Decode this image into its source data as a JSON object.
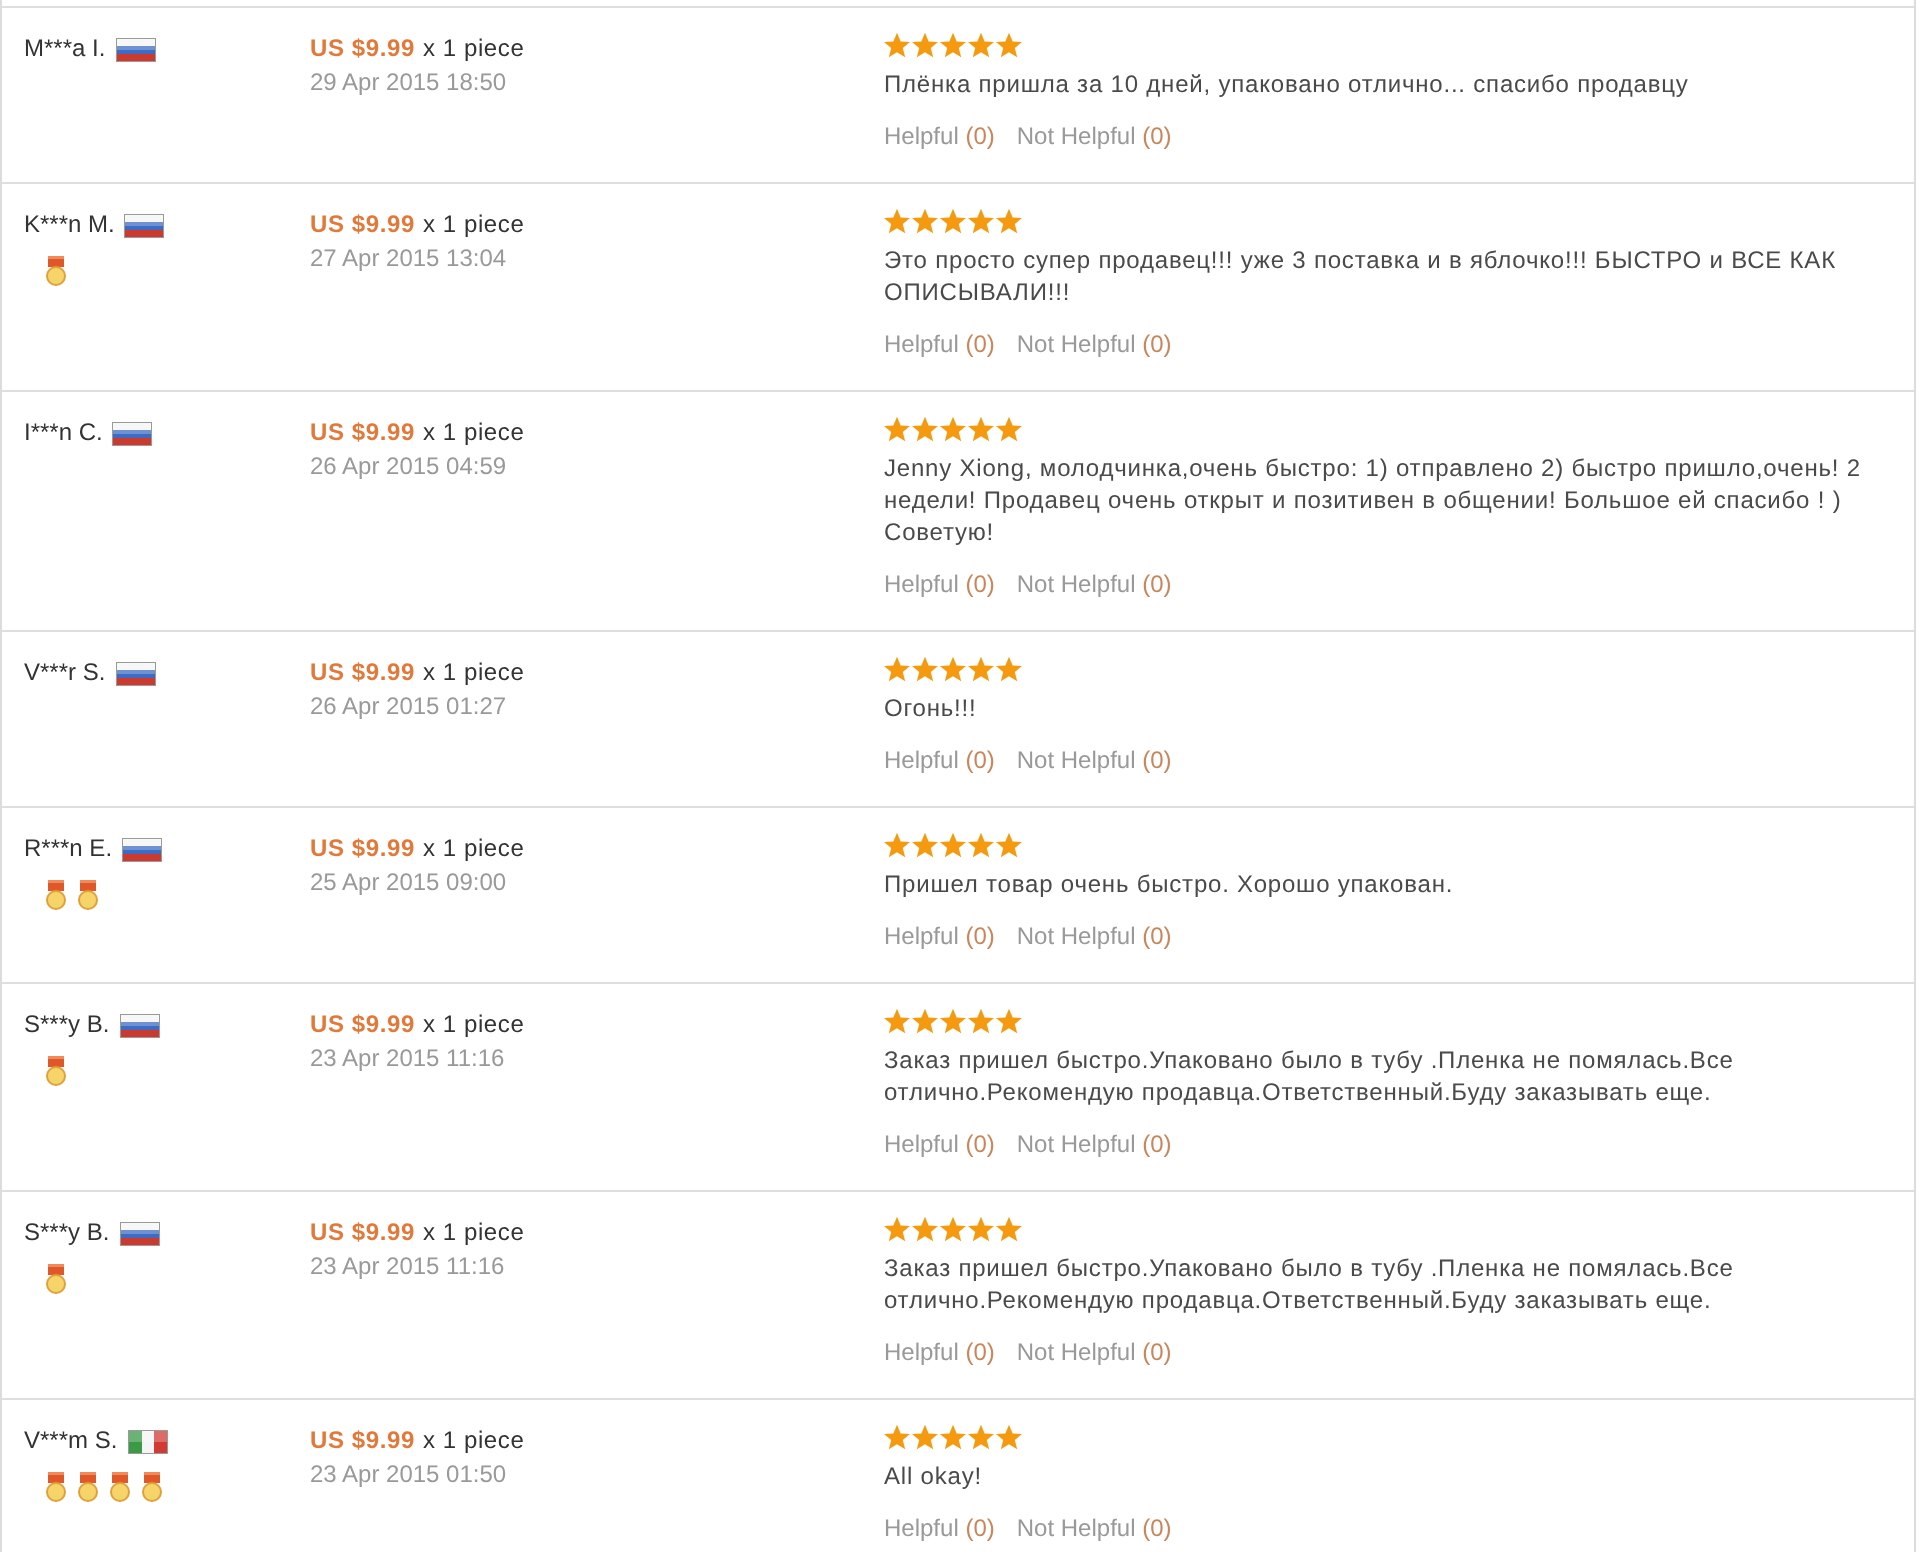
{
  "reviews": [
    {
      "buyer": "M***a I.",
      "flag": {
        "kind": "russia"
      },
      "price": "US $9.99",
      "quantity": "x 1 piece",
      "date": "29 Apr 2015 18:50",
      "stars": 5,
      "text": "Плёнка пришла за 10 дней, упаковано отлично... спасибо продавцу",
      "helpful": {
        "label": "Helpful",
        "count": "(0)"
      },
      "not_helpful": {
        "label": "Not Helpful",
        "count": "(0)"
      }
    },
    {
      "buyer": "K***n M.",
      "flag": {
        "kind": "russia"
      },
      "badges": [
        {
          "kind": "medal"
        }
      ],
      "price": "US $9.99",
      "quantity": "x 1 piece",
      "date": "27 Apr 2015 13:04",
      "stars": 5,
      "text": "Это просто супер продавец!!! уже 3 поставка и в яблочко!!! БЫСТРО и ВСЕ КАК ОПИСЫВАЛИ!!!",
      "helpful": {
        "label": "Helpful",
        "count": "(0)"
      },
      "not_helpful": {
        "label": "Not Helpful",
        "count": "(0)"
      }
    },
    {
      "buyer": "I***n C.",
      "flag": {
        "kind": "russia"
      },
      "price": "US $9.99",
      "quantity": "x 1 piece",
      "date": "26 Apr 2015 04:59",
      "stars": 5,
      "text": "Jenny Xiong, молодчинка,очень быстро: 1) отправлено 2) быстро пришло,очень! 2 недели! Продавец очень открыт и позитивен в общении! Большое ей спасибо ! ) Советую!",
      "helpful": {
        "label": "Helpful",
        "count": "(0)"
      },
      "not_helpful": {
        "label": "Not Helpful",
        "count": "(0)"
      }
    },
    {
      "buyer": "V***r S.",
      "flag": {
        "kind": "russia"
      },
      "price": "US $9.99",
      "quantity": "x 1 piece",
      "date": "26 Apr 2015 01:27",
      "stars": 5,
      "text": "Огонь!!!",
      "helpful": {
        "label": "Helpful",
        "count": "(0)"
      },
      "not_helpful": {
        "label": "Not Helpful",
        "count": "(0)"
      }
    },
    {
      "buyer": "R***n E.",
      "flag": {
        "kind": "russia"
      },
      "badges": [
        {
          "kind": "medal"
        },
        {
          "kind": "medal"
        }
      ],
      "price": "US $9.99",
      "quantity": "x 1 piece",
      "date": "25 Apr 2015 09:00",
      "stars": 5,
      "text": "Пришел товар очень быстро. Хорошо упакован.",
      "helpful": {
        "label": "Helpful",
        "count": "(0)"
      },
      "not_helpful": {
        "label": "Not Helpful",
        "count": "(0)"
      }
    },
    {
      "buyer": "S***y B.",
      "flag": {
        "kind": "russia"
      },
      "badges": [
        {
          "kind": "medal"
        }
      ],
      "price": "US $9.99",
      "quantity": "x 1 piece",
      "date": "23 Apr 2015 11:16",
      "stars": 5,
      "text": "Заказ пришел быстро.Упаковано было в тубу .Пленка не помялась.Все отлично.Рекомендую продавца.Ответственный.Буду заказывать еще.",
      "helpful": {
        "label": "Helpful",
        "count": "(0)"
      },
      "not_helpful": {
        "label": "Not Helpful",
        "count": "(0)"
      }
    },
    {
      "buyer": "S***y B.",
      "flag": {
        "kind": "russia"
      },
      "badges": [
        {
          "kind": "medal"
        }
      ],
      "price": "US $9.99",
      "quantity": "x 1 piece",
      "date": "23 Apr 2015 11:16",
      "stars": 5,
      "text": "Заказ пришел быстро.Упаковано было в тубу .Пленка не помялась.Все отлично.Рекомендую продавца.Ответственный.Буду заказывать еще.",
      "helpful": {
        "label": "Helpful",
        "count": "(0)"
      },
      "not_helpful": {
        "label": "Not Helpful",
        "count": "(0)"
      }
    },
    {
      "buyer": "V***m S.",
      "flag": {
        "kind": "italy"
      },
      "badges": [
        {
          "kind": "medal"
        },
        {
          "kind": "medal"
        },
        {
          "kind": "medal"
        },
        {
          "kind": "medal"
        }
      ],
      "price": "US $9.99",
      "quantity": "x 1 piece",
      "date": "23 Apr 2015 01:50",
      "stars": 5,
      "text": "All okay!",
      "helpful": {
        "label": "Helpful",
        "count": "(0)"
      },
      "not_helpful": {
        "label": "Not Helpful",
        "count": "(0)"
      }
    }
  ]
}
